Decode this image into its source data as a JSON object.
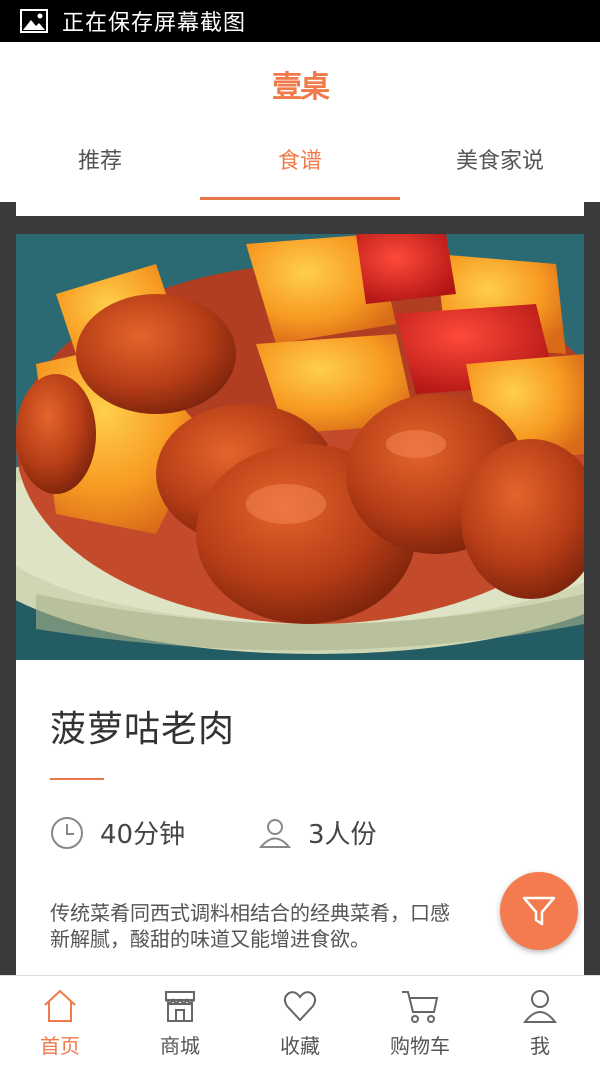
{
  "status_bar": {
    "text": "正在保存屏幕截图",
    "icon": "image-icon"
  },
  "header": {
    "logo": "壹桌"
  },
  "tabs": [
    {
      "label": "推荐",
      "active": false
    },
    {
      "label": "食谱",
      "active": true
    },
    {
      "label": "美食家说",
      "active": false
    }
  ],
  "recipe": {
    "title": "菠萝咕老肉",
    "time": "40分钟",
    "servings": "3人份",
    "description_line1": "传统菜肴同西式调料相结合的经典菜肴，口感",
    "description_line2": "新解腻，酸甜的味道又能增进食欲。"
  },
  "bottom_nav": [
    {
      "label": "首页",
      "icon": "home-icon",
      "active": true
    },
    {
      "label": "商城",
      "icon": "store-icon",
      "active": false
    },
    {
      "label": "收藏",
      "icon": "heart-icon",
      "active": false
    },
    {
      "label": "购物车",
      "icon": "cart-icon",
      "active": false
    },
    {
      "label": "我",
      "icon": "user-icon",
      "active": false
    }
  ],
  "colors": {
    "accent": "#f07a4a",
    "fab": "#f47a4f"
  }
}
